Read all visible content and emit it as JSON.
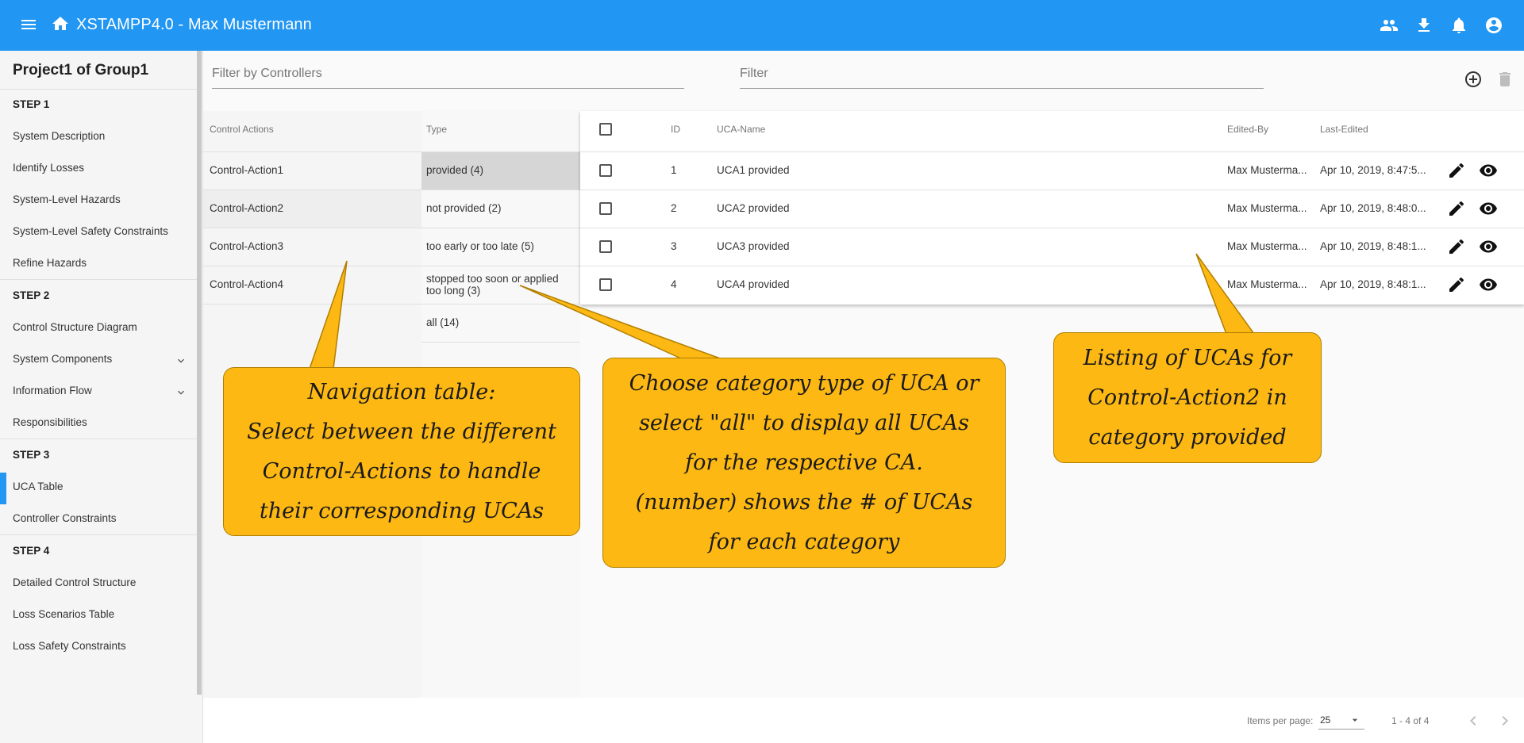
{
  "app": {
    "title": "XSTAMPP4.0 - Max Mustermann"
  },
  "sidebar": {
    "project_title": "Project1 of Group1",
    "steps": [
      {
        "label": "STEP 1",
        "items": [
          "System Description",
          "Identify Losses",
          "System-Level Hazards",
          "System-Level Safety Constraints",
          "Refine Hazards"
        ]
      },
      {
        "label": "STEP 2",
        "items": [
          "Control Structure Diagram",
          "System Components",
          "Information Flow",
          "Responsibilities"
        ]
      },
      {
        "label": "STEP 3",
        "items": [
          "UCA Table",
          "Controller Constraints"
        ]
      },
      {
        "label": "STEP 4",
        "items": [
          "Detailed Control Structure",
          "Loss Scenarios Table",
          "Loss Safety Constraints"
        ]
      }
    ],
    "active_item": "UCA Table"
  },
  "filters": {
    "controllers_placeholder": "Filter by Controllers",
    "filter_placeholder": "Filter"
  },
  "nav_table": {
    "headers": {
      "control_actions": "Control Actions",
      "type": "Type"
    },
    "control_actions": [
      "Control-Action1",
      "Control-Action2",
      "Control-Action3",
      "Control-Action4"
    ],
    "types": [
      "provided (4)",
      "not provided (2)",
      "too early or too late (5)",
      "stopped too soon or applied too long (3)",
      "all (14)"
    ]
  },
  "uca_table": {
    "headers": {
      "id": "ID",
      "name": "UCA-Name",
      "edited_by": "Edited-By",
      "last_edited": "Last-Edited"
    },
    "rows": [
      {
        "id": "1",
        "name": "UCA1 provided",
        "edited_by": "Max Musterma...",
        "last_edited": "Apr 10, 2019, 8:47:5..."
      },
      {
        "id": "2",
        "name": "UCA2 provided",
        "edited_by": "Max Musterma...",
        "last_edited": "Apr 10, 2019, 8:48:0..."
      },
      {
        "id": "3",
        "name": "UCA3 provided",
        "edited_by": "Max Musterma...",
        "last_edited": "Apr 10, 2019, 8:48:1..."
      },
      {
        "id": "4",
        "name": "UCA4 provided",
        "edited_by": "Max Musterma...",
        "last_edited": "Apr 10, 2019, 8:48:1..."
      }
    ]
  },
  "paginator": {
    "items_per_page_label": "Items per page:",
    "items_per_page_value": "25",
    "range": "1 - 4 of 4"
  },
  "callouts": {
    "navigation": [
      "Navigation table:",
      "Select between the different",
      "Control-Actions to handle",
      "their corresponding UCAs"
    ],
    "category": [
      "Choose category type of UCA or",
      "select \"all\" to display all UCAs",
      "for the respective CA.",
      "(number) shows the # of UCAs",
      "for each category"
    ],
    "listing": [
      "Listing of UCAs for",
      "Control-Action2 in",
      "category provided"
    ]
  },
  "colors": {
    "primary": "#2196f3",
    "callout": "#fdb813"
  }
}
